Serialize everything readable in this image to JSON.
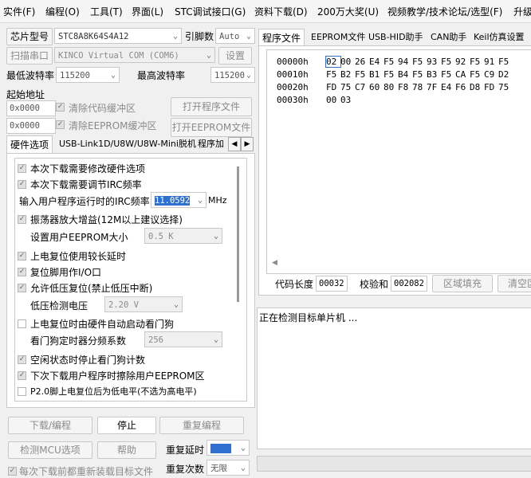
{
  "menu": [
    "实件(F)",
    "编程(O)",
    "工具(T)",
    "界面(L)",
    "STC调试接口(G)",
    "资料下载(D)",
    "200万大奖(U)",
    "视频教学/技术论坛/选型(F)",
    "升级"
  ],
  "chip": {
    "label": "芯片型号",
    "value": "STC8A8K64S4A12",
    "pins_label": "引脚数",
    "pins_value": "Auto"
  },
  "port": {
    "scan_button": "扫描串口",
    "value": "KINCO Virtual COM (COM6)",
    "settings_button": "设置"
  },
  "baud": {
    "min_label": "最低波特率",
    "min_value": "115200",
    "max_label": "最高波特率",
    "max_value": "115200"
  },
  "start_addr": {
    "label": "起始地址",
    "code_addr": "0x0000",
    "clear_code": "清除代码缓冲区",
    "open_prog_button": "打开程序文件",
    "eeprom_addr": "0x0000",
    "clear_eeprom": "清除EEPROM缓冲区",
    "open_eeprom_button": "打开EEPROM文件"
  },
  "left_tabs": [
    "硬件选项",
    "USB-Link1D/U8W/U8W-Mini脱机",
    "程序加"
  ],
  "options": {
    "o1": "本次下载需要修改硬件选项",
    "o2": "本次下载需要调节IRC频率",
    "irc_label": "输入用户程序运行时的IRC频率",
    "irc_value": "11.0592",
    "irc_unit": "MHz",
    "o3": "振荡器放大增益(12M以上建议选择)",
    "eeprom_size_label": "设置用户EEPROM大小",
    "eeprom_size_value": "0.5 K",
    "o4": "上电复位使用较长延时",
    "o5": "复位脚用作I/O口",
    "o6": "允许低压复位(禁止低压中断)",
    "lvd_label": "低压检测电压",
    "lvd_value": "2.20 V",
    "o7": "上电复位时由硬件自动启动看门狗",
    "wdt_label": "看门狗定时器分频系数",
    "wdt_value": "256",
    "o8": "空闲状态时停止看门狗计数",
    "o9": "下次下载用户程序时擦除用户EEPROM区",
    "o10": "P2.0脚上电复位后为低电平(不选为高电平)"
  },
  "bottom": {
    "download": "下载/编程",
    "stop": "停止",
    "reprogram": "重复编程",
    "detect": "检测MCU选项",
    "help": "帮助",
    "repeat_delay_label": "重复延时",
    "repeat_delay_value": "",
    "repeat_count_label": "重复次数",
    "repeat_count_value": "无限",
    "reload_label": "每次下载前都重新装载目标文件"
  },
  "right_tabs": [
    "程序文件",
    "EEPROM文件",
    "USB-HID助手",
    "CAN助手",
    "Keil仿真设置"
  ],
  "hex": [
    {
      "addr": "00000h",
      "bytes": [
        "02",
        "00",
        "26",
        "E4",
        "F5",
        "94",
        "F5",
        "93",
        "F5",
        "92",
        "F5",
        "91",
        "F5"
      ]
    },
    {
      "addr": "00010h",
      "bytes": [
        "F5",
        "B2",
        "F5",
        "B1",
        "F5",
        "B4",
        "F5",
        "B3",
        "F5",
        "CA",
        "F5",
        "C9",
        "D2"
      ]
    },
    {
      "addr": "00020h",
      "bytes": [
        "FD",
        "75",
        "C7",
        "60",
        "80",
        "F8",
        "78",
        "7F",
        "E4",
        "F6",
        "D8",
        "FD",
        "75"
      ]
    },
    {
      "addr": "00030h",
      "bytes": [
        "00",
        "03"
      ]
    }
  ],
  "code_stats": {
    "length_label": "代码长度",
    "length_value": "00032",
    "checksum_label": "校验和",
    "checksum_value": "002082",
    "fill_button": "区域填充",
    "clear_button": "清空区"
  },
  "log": {
    "text": "正在检测目标单片机 ..."
  }
}
